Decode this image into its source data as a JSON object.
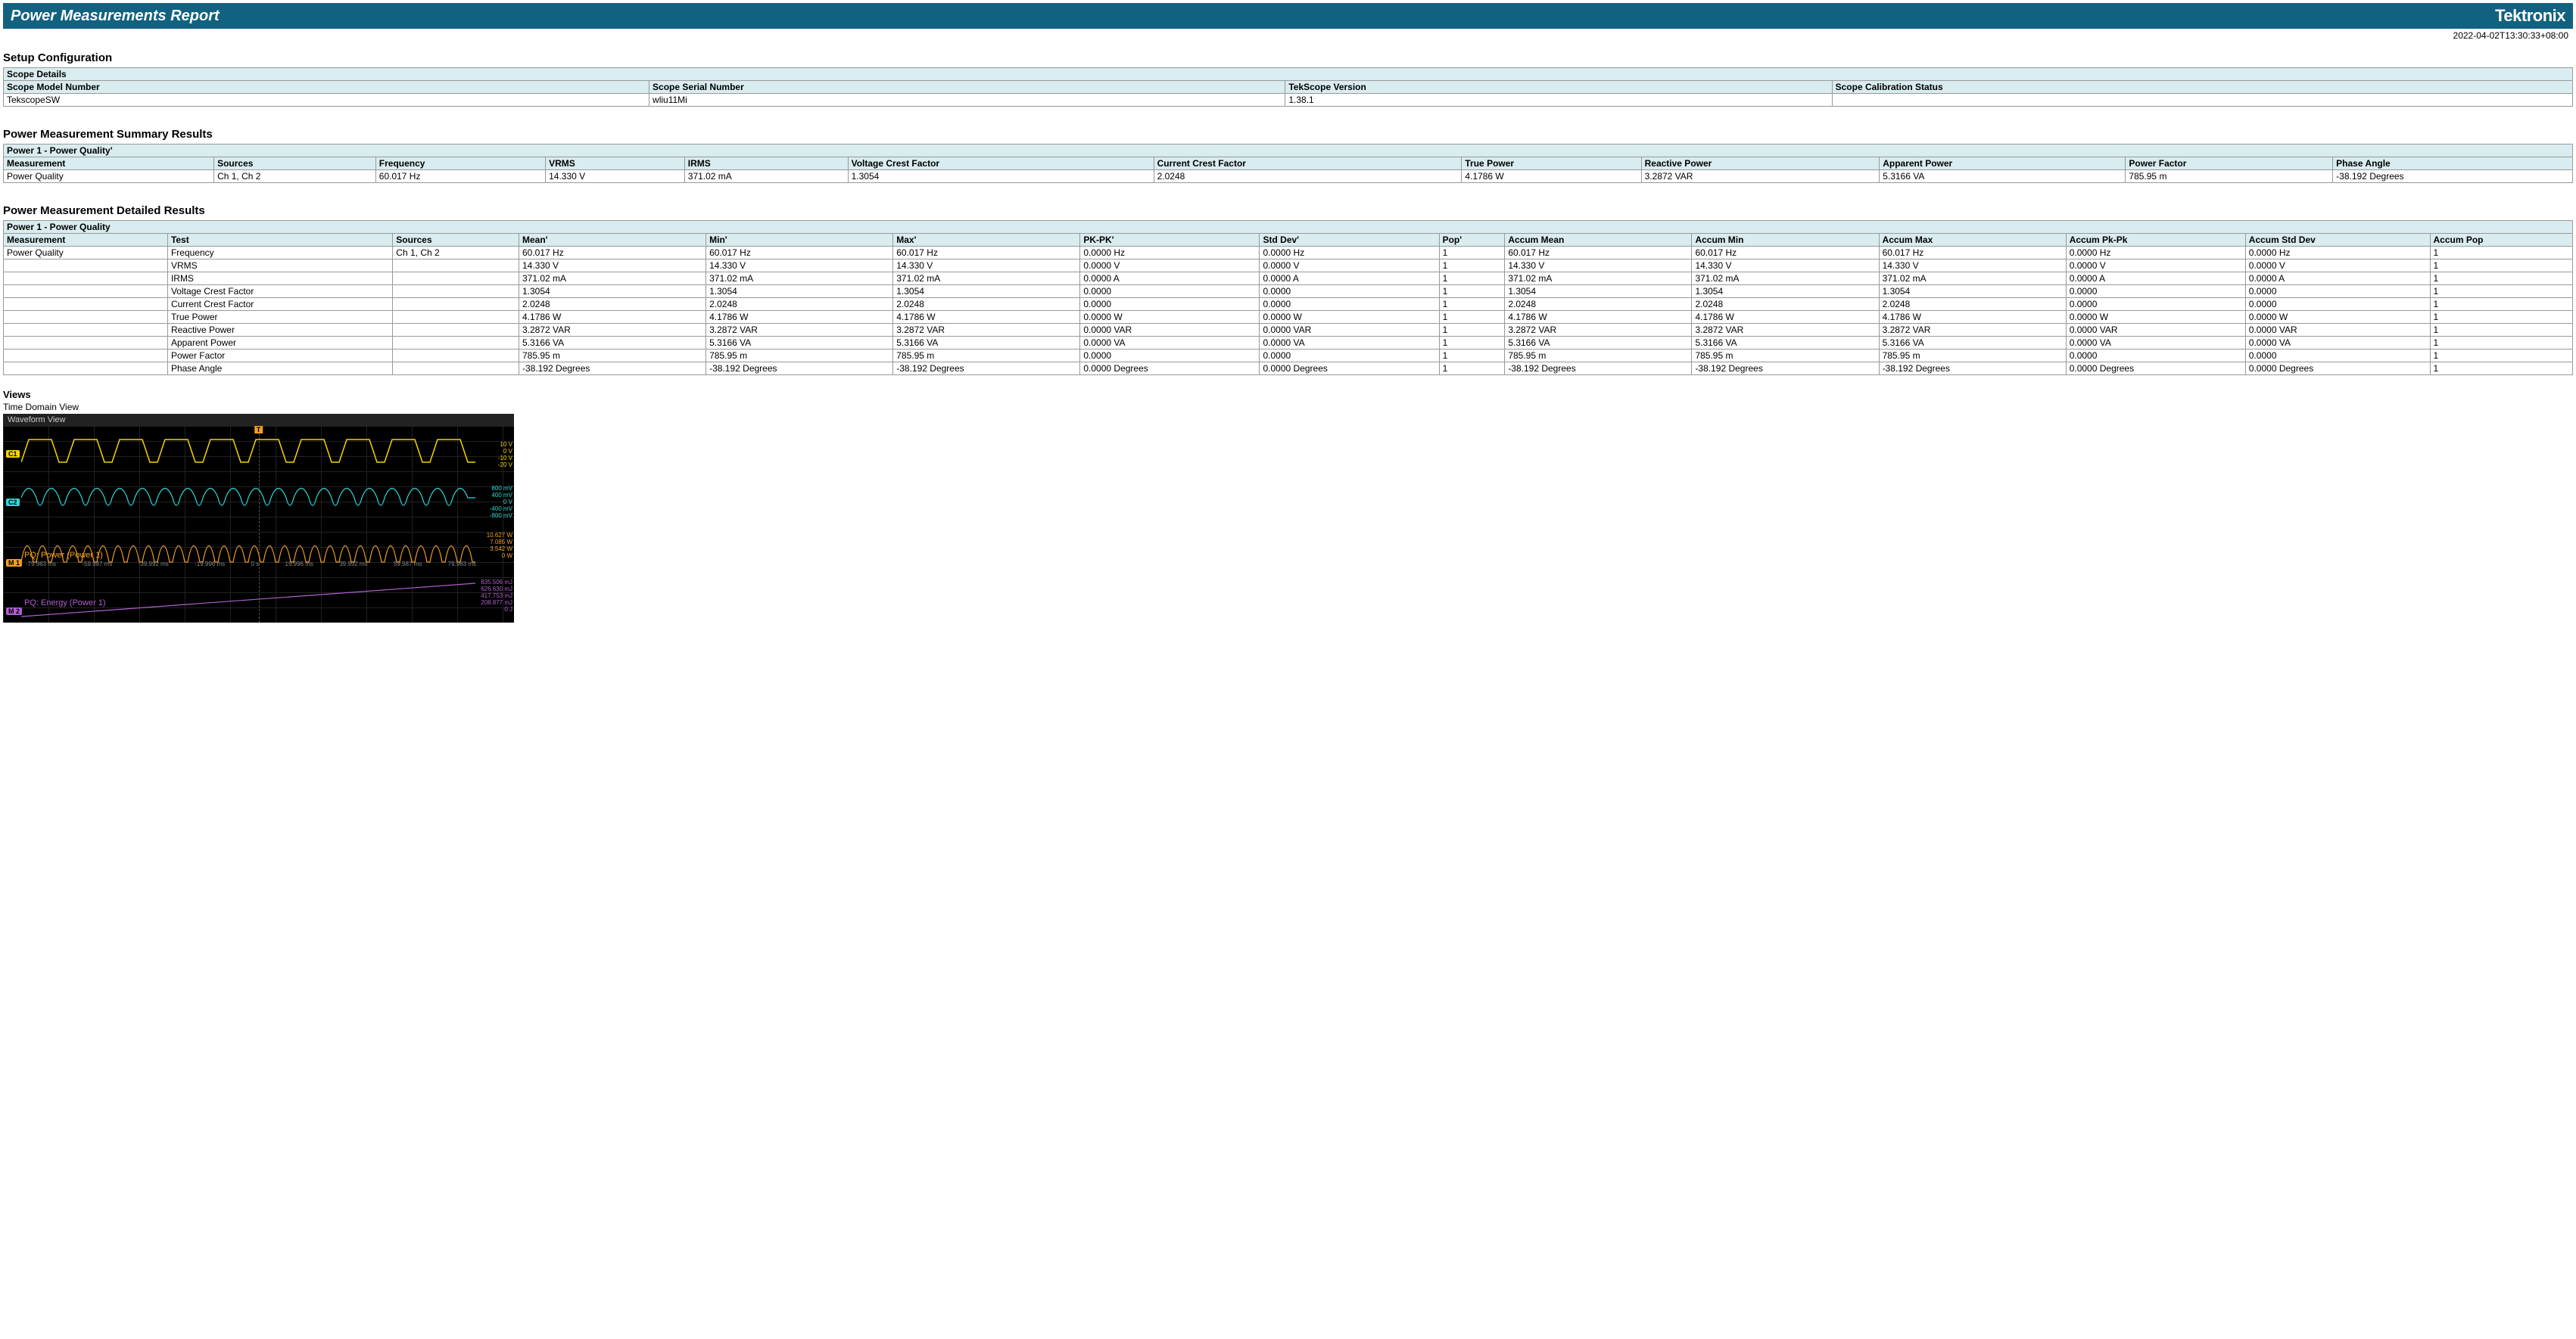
{
  "header": {
    "title": "Power Measurements Report",
    "brand": "Tektronix",
    "timestamp": "2022-04-02T13:30:33+08:00"
  },
  "setup": {
    "heading": "Setup Configuration",
    "scopeDetailsLabel": "Scope Details",
    "cols": [
      "Scope Model Number",
      "Scope Serial Number",
      "TekScope Version",
      "Scope Calibration Status"
    ],
    "row": [
      "TekscopeSW",
      "wliu11Mi",
      "1.38.1",
      ""
    ]
  },
  "summary": {
    "heading": "Power Measurement Summary Results",
    "caption": "Power 1 - Power Quality'",
    "cols": [
      "Measurement",
      "Sources",
      "Frequency",
      "VRMS",
      "IRMS",
      "Voltage Crest Factor",
      "Current Crest Factor",
      "True Power",
      "Reactive Power",
      "Apparent Power",
      "Power Factor",
      "Phase Angle"
    ],
    "row": [
      "Power Quality",
      "Ch 1, Ch 2",
      "60.017 Hz",
      "14.330 V",
      "371.02 mA",
      "1.3054",
      "2.0248",
      "4.1786 W",
      "3.2872 VAR",
      "5.3166 VA",
      "785.95 m",
      "-38.192 Degrees"
    ]
  },
  "detailed": {
    "heading": "Power Measurement Detailed Results",
    "caption": "Power 1 - Power Quality",
    "cols": [
      "Measurement",
      "Test",
      "Sources",
      "Mean'",
      "Min'",
      "Max'",
      "PK-PK'",
      "Std Dev'",
      "Pop'",
      "Accum Mean",
      "Accum Min",
      "Accum Max",
      "Accum Pk-Pk",
      "Accum Std Dev",
      "Accum Pop"
    ],
    "rows": [
      [
        "Power Quality",
        "Frequency",
        "Ch 1, Ch 2",
        "60.017 Hz",
        "60.017 Hz",
        "60.017 Hz",
        "0.0000 Hz",
        "0.0000 Hz",
        "1",
        "60.017 Hz",
        "60.017 Hz",
        "60.017 Hz",
        "0.0000 Hz",
        "0.0000 Hz",
        "1"
      ],
      [
        "",
        "VRMS",
        "",
        "14.330 V",
        "14.330 V",
        "14.330 V",
        "0.0000 V",
        "0.0000 V",
        "1",
        "14.330 V",
        "14.330 V",
        "14.330 V",
        "0.0000 V",
        "0.0000 V",
        "1"
      ],
      [
        "",
        "IRMS",
        "",
        "371.02 mA",
        "371.02 mA",
        "371.02 mA",
        "0.0000 A",
        "0.0000 A",
        "1",
        "371.02 mA",
        "371.02 mA",
        "371.02 mA",
        "0.0000 A",
        "0.0000 A",
        "1"
      ],
      [
        "",
        "Voltage Crest Factor",
        "",
        "1.3054",
        "1.3054",
        "1.3054",
        "0.0000",
        "0.0000",
        "1",
        "1.3054",
        "1.3054",
        "1.3054",
        "0.0000",
        "0.0000",
        "1"
      ],
      [
        "",
        "Current Crest Factor",
        "",
        "2.0248",
        "2.0248",
        "2.0248",
        "0.0000",
        "0.0000",
        "1",
        "2.0248",
        "2.0248",
        "2.0248",
        "0.0000",
        "0.0000",
        "1"
      ],
      [
        "",
        "True Power",
        "",
        "4.1786 W",
        "4.1786 W",
        "4.1786 W",
        "0.0000 W",
        "0.0000 W",
        "1",
        "4.1786 W",
        "4.1786 W",
        "4.1786 W",
        "0.0000 W",
        "0.0000 W",
        "1"
      ],
      [
        "",
        "Reactive Power",
        "",
        "3.2872 VAR",
        "3.2872 VAR",
        "3.2872 VAR",
        "0.0000 VAR",
        "0.0000 VAR",
        "1",
        "3.2872 VAR",
        "3.2872 VAR",
        "3.2872 VAR",
        "0.0000 VAR",
        "0.0000 VAR",
        "1"
      ],
      [
        "",
        "Apparent Power",
        "",
        "5.3166 VA",
        "5.3166 VA",
        "5.3166 VA",
        "0.0000 VA",
        "0.0000 VA",
        "1",
        "5.3166 VA",
        "5.3166 VA",
        "5.3166 VA",
        "0.0000 VA",
        "0.0000 VA",
        "1"
      ],
      [
        "",
        "Power Factor",
        "",
        "785.95 m",
        "785.95 m",
        "785.95 m",
        "0.0000",
        "0.0000",
        "1",
        "785.95 m",
        "785.95 m",
        "785.95 m",
        "0.0000",
        "0.0000",
        "1"
      ],
      [
        "",
        "Phase Angle",
        "",
        "-38.192 Degrees",
        "-38.192 Degrees",
        "-38.192 Degrees",
        "0.0000 Degrees",
        "0.0000 Degrees",
        "1",
        "-38.192 Degrees",
        "-38.192 Degrees",
        "-38.192 Degrees",
        "0.0000 Degrees",
        "0.0000 Degrees",
        "1"
      ]
    ]
  },
  "views": {
    "heading": "Views",
    "subheading": "Time Domain View",
    "waveformTitle": "Waveform View",
    "trigger": "T",
    "channels": {
      "c1": "C1",
      "c2": "C2",
      "m1": "M 1",
      "m2": "M 2"
    },
    "traceLabels": {
      "m1": "PQ: Power (Power 1)",
      "m2": "PQ: Energy (Power 1)"
    },
    "scales": {
      "c1": [
        "10 V",
        "0 V",
        "-10 V",
        "-20 V"
      ],
      "c2": [
        "800 mV",
        "400 mV",
        "0 V",
        "-400 mV",
        "-800 mV"
      ],
      "m1": [
        "10.627 W",
        "7.085 W",
        "3.542 W",
        "0 W"
      ],
      "m2": [
        "835.506 mJ",
        "626.630 mJ",
        "417.753 mJ",
        "208.877 mJ",
        "0 J"
      ]
    },
    "timeAxis": [
      "-79.983 ms",
      "-59.987 ms",
      "-39.992 ms",
      "-19.996 ms",
      "0 s",
      "19.996 ms",
      "39.992 ms",
      "59.987 ms",
      "79.983 ms"
    ]
  }
}
